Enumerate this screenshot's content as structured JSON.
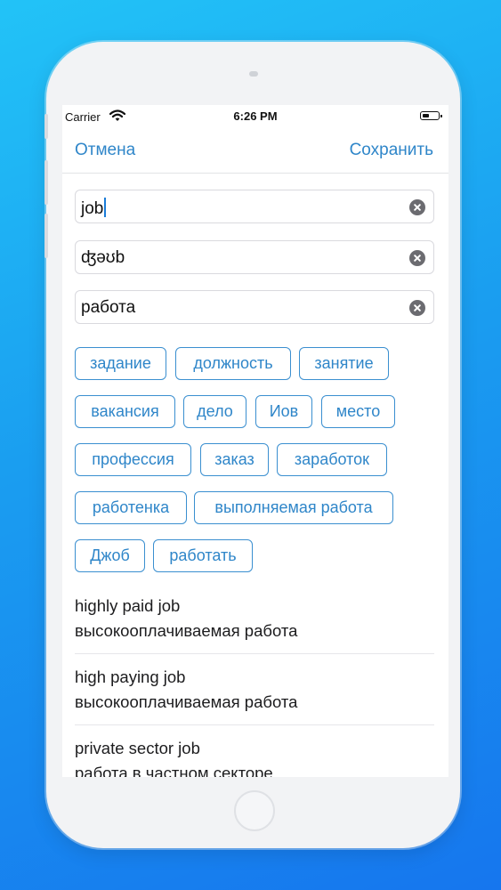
{
  "status_bar": {
    "carrier": "Carrier",
    "time": "6:26 PM"
  },
  "nav": {
    "cancel_label": "Отмена",
    "save_label": "Сохранить"
  },
  "fields": [
    {
      "value": "job"
    },
    {
      "value": "ʤəʊb"
    },
    {
      "value": "работа"
    }
  ],
  "translations": [
    "задание",
    "должность",
    "занятие",
    "вакансия",
    "дело",
    "Иов",
    "место",
    "профессия",
    "заказ",
    "заработок",
    "работенка",
    "выполняемая работа",
    "Джоб",
    "работать"
  ],
  "examples": [
    {
      "en": "highly paid job",
      "ru": "высокооплачиваемая работа"
    },
    {
      "en": "high paying job",
      "ru": "высокооплачиваемая работа"
    },
    {
      "en": "private sector job",
      "ru": "работа в частном секторе"
    }
  ],
  "colors": {
    "accent": "#2f86c9",
    "background_top": "#22c3f7",
    "background_bottom": "#1676ee"
  }
}
